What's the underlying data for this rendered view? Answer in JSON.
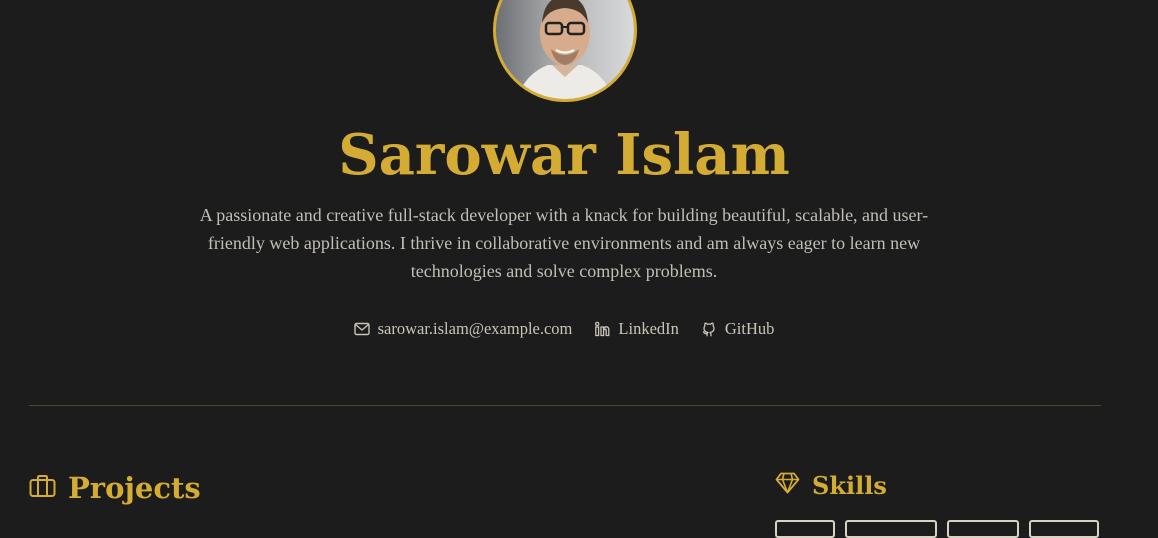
{
  "profile": {
    "name": "Sarowar Islam",
    "bio": "A passionate and creative full-stack developer with a knack for building beautiful, scalable, and user-friendly web applications. I thrive in collaborative environments and am always eager to learn new technologies and solve complex problems."
  },
  "contacts": {
    "email": {
      "label": "sarowar.islam@example.com",
      "icon": "mail-icon"
    },
    "linkedin": {
      "label": "LinkedIn",
      "icon": "linkedin-icon"
    },
    "github": {
      "label": "GitHub",
      "icon": "github-icon"
    }
  },
  "sections": {
    "projects": {
      "title": "Projects",
      "icon": "briefcase-icon"
    },
    "skills": {
      "title": "Skills",
      "icon": "diamond-icon"
    }
  },
  "colors": {
    "background": "#1c1c1c",
    "accent": "#d4ac34",
    "text": "#c9c4b6"
  }
}
